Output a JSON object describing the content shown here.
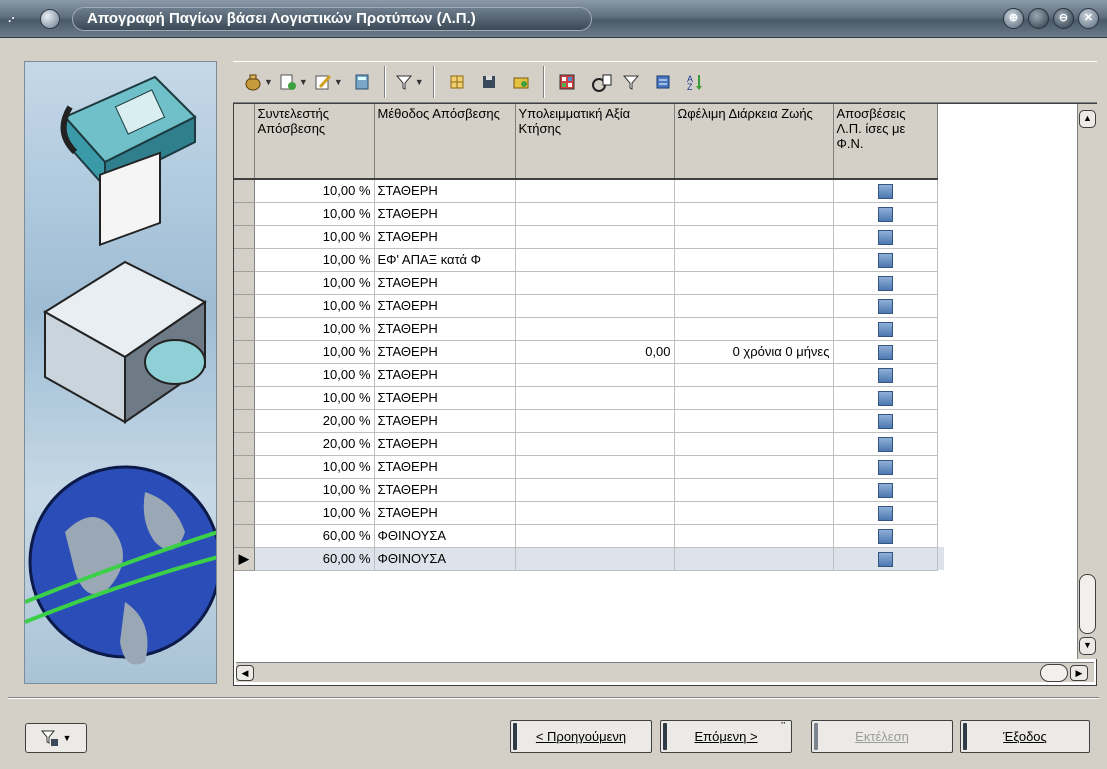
{
  "window": {
    "title": "Απογραφή Παγίων βάσει Λογιστικών Προτύπων (Λ.Π.)"
  },
  "grid": {
    "columns": [
      "Συντελεστής Απόσβεσης",
      "Μέθοδος Απόσβεσης",
      "Υπολειμματική Αξία Κτήσης",
      "Ωφέλιμη Διάρκεια Ζωής",
      "Αποσβέσεις Λ.Π. ίσες με Φ.Ν."
    ],
    "rows": [
      {
        "rate": "10,00 %",
        "method": "ΣΤΑΘΕΡΗ",
        "residual": "",
        "life": "",
        "checked": true
      },
      {
        "rate": "10,00 %",
        "method": "ΣΤΑΘΕΡΗ",
        "residual": "",
        "life": "",
        "checked": true
      },
      {
        "rate": "10,00 %",
        "method": "ΣΤΑΘΕΡΗ",
        "residual": "",
        "life": "",
        "checked": true
      },
      {
        "rate": "10,00 %",
        "method": "ΕΦ' ΑΠΑΞ κατά Φ",
        "residual": "",
        "life": "",
        "checked": true
      },
      {
        "rate": "10,00 %",
        "method": "ΣΤΑΘΕΡΗ",
        "residual": "",
        "life": "",
        "checked": true
      },
      {
        "rate": "10,00 %",
        "method": "ΣΤΑΘΕΡΗ",
        "residual": "",
        "life": "",
        "checked": true
      },
      {
        "rate": "10,00 %",
        "method": "ΣΤΑΘΕΡΗ",
        "residual": "",
        "life": "",
        "checked": true
      },
      {
        "rate": "10,00 %",
        "method": "ΣΤΑΘΕΡΗ",
        "residual": "0,00",
        "life": "0 χρόνια 0 μήνες",
        "checked": true
      },
      {
        "rate": "10,00 %",
        "method": "ΣΤΑΘΕΡΗ",
        "residual": "",
        "life": "",
        "checked": true
      },
      {
        "rate": "10,00 %",
        "method": "ΣΤΑΘΕΡΗ",
        "residual": "",
        "life": "",
        "checked": true
      },
      {
        "rate": "20,00 %",
        "method": "ΣΤΑΘΕΡΗ",
        "residual": "",
        "life": "",
        "checked": true
      },
      {
        "rate": "20,00 %",
        "method": "ΣΤΑΘΕΡΗ",
        "residual": "",
        "life": "",
        "checked": true
      },
      {
        "rate": "10,00 %",
        "method": "ΣΤΑΘΕΡΗ",
        "residual": "",
        "life": "",
        "checked": true
      },
      {
        "rate": "10,00 %",
        "method": "ΣΤΑΘΕΡΗ",
        "residual": "",
        "life": "",
        "checked": true
      },
      {
        "rate": "10,00 %",
        "method": "ΣΤΑΘΕΡΗ",
        "residual": "",
        "life": "",
        "checked": true
      },
      {
        "rate": "60,00 %",
        "method": "ΦΘΙΝΟΥΣΑ",
        "residual": "",
        "life": "",
        "checked": true
      },
      {
        "rate": "60,00 %",
        "method": "ΦΘΙΝΟΥΣΑ",
        "residual": "",
        "life": "",
        "checked": true,
        "current": true
      }
    ],
    "current_row_marker": "▶"
  },
  "toolbar": {
    "icons": [
      "money-bag-icon",
      "add-record-icon",
      "edit-icon",
      "calculator-icon",
      "filter-icon",
      "grid-icon",
      "save-icon",
      "open-folder-icon",
      "layout-icon",
      "columns-icon",
      "filter-icon",
      "list-icon",
      "sort-icon"
    ]
  },
  "buttons": {
    "previous": "< Προηγούμενη",
    "next": "Επόμενη >",
    "execute": "Εκτέλεση",
    "exit": "Έξοδος"
  },
  "colors": {
    "titlebar": "#5f6f7e",
    "checkbox": "#4d78b0",
    "current_row": "#dde3ea"
  }
}
